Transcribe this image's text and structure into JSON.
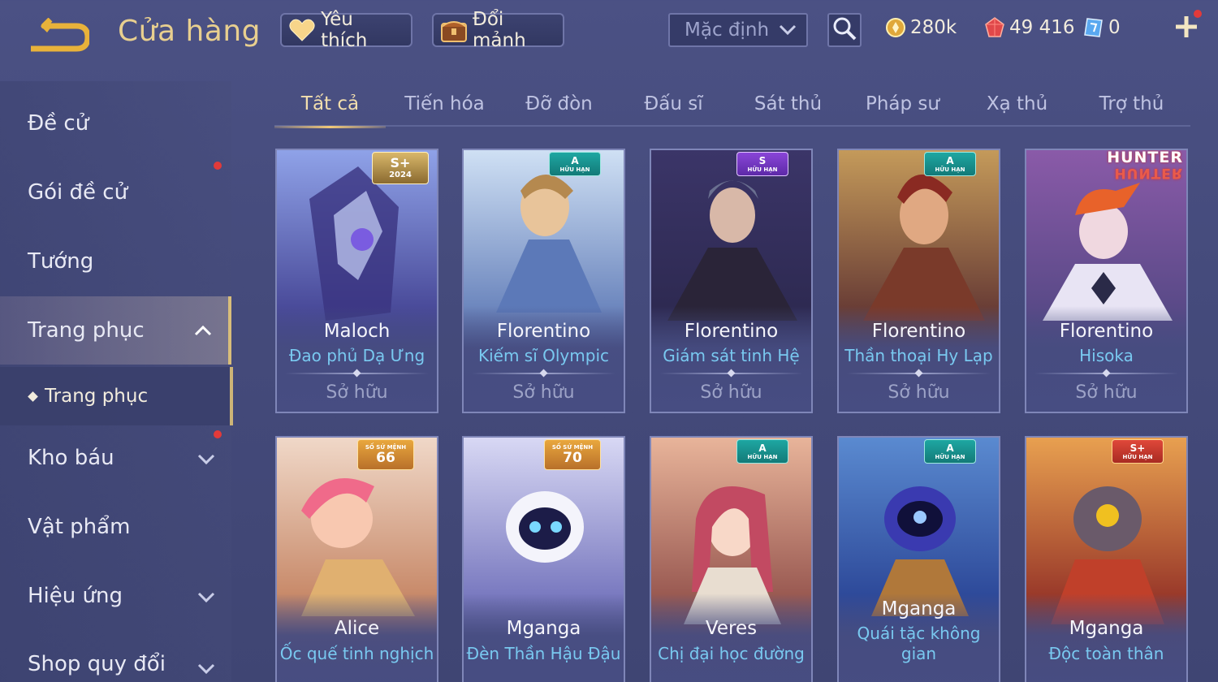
{
  "header": {
    "title": "Cửa hàng",
    "favorites_label": "Yêu thích",
    "exchange_label": "Đổi mảnh",
    "sort_value": "Mặc định",
    "gold": "280k",
    "gems": "49 416",
    "vouchers": "0"
  },
  "sidebar": {
    "items": [
      {
        "label": "Đề cử"
      },
      {
        "label": "Gói đề cử"
      },
      {
        "label": "Tướng"
      },
      {
        "label": "Trang phục"
      },
      {
        "label": "Kho báu"
      },
      {
        "label": "Vật phẩm"
      },
      {
        "label": "Hiệu ứng"
      },
      {
        "label": "Shop quy đổi"
      }
    ],
    "sub_item": "Trang phục"
  },
  "tabs": [
    "Tất cả",
    "Tiến hóa",
    "Đỡ đòn",
    "Đấu sĩ",
    "Sát thủ",
    "Pháp sư",
    "Xạ thủ",
    "Trợ thủ"
  ],
  "cards": [
    {
      "hero": "Maloch",
      "skin": "Đao phủ Dạ Ưng",
      "status": "Sở hữu",
      "badge": "S+",
      "badge_sub": "2024",
      "color": "#5b5fb0"
    },
    {
      "hero": "Florentino",
      "skin": "Kiếm sĩ Olympic",
      "status": "Sở hữu",
      "badge": "A",
      "badge_sub": "HỮU HẠN",
      "color": "#6e8ac2"
    },
    {
      "hero": "Florentino",
      "skin": "Giám sát tinh Hệ",
      "status": "Sở hữu",
      "badge": "S",
      "badge_sub": "HỮU HẠN",
      "color": "#3a3260"
    },
    {
      "hero": "Florentino",
      "skin": "Thần thoại Hy Lạp",
      "status": "Sở hữu",
      "badge": "A",
      "badge_sub": "HỮU HẠN",
      "color": "#8a5a3c"
    },
    {
      "hero": "Florentino",
      "skin": "Hisoka",
      "status": "Sở hữu",
      "logo": "HUNTER",
      "color": "#6a4a8c"
    },
    {
      "hero": "Alice",
      "skin": "Ốc quế tinh nghịch",
      "badge": "SỐ SỨ MỆNH",
      "badge_sub": "66",
      "color": "#d88a6a"
    },
    {
      "hero": "Mganga",
      "skin": "Đèn Thần Hậu Đậu",
      "badge": "SỐ SỨ MỆNH",
      "badge_sub": "70",
      "color": "#8a8ad0"
    },
    {
      "hero": "Veres",
      "skin": "Chị đại học đường",
      "badge": "A",
      "badge_sub": "HỮU HẠN",
      "color": "#b46a5a"
    },
    {
      "hero": "Mganga",
      "skin": "Quái tặc không gian",
      "badge": "A",
      "badge_sub": "HỮU HẠN",
      "color": "#3a5ab0"
    },
    {
      "hero": "Mganga",
      "skin": "Độc toàn thân",
      "badge": "S+",
      "badge_sub": "HỮU HẠN",
      "color": "#b0502a"
    }
  ],
  "colors": {
    "accent_gold": "#e8cf8f",
    "skin_name_blue": "#79c9f0",
    "badge_red_dot": "#e23a3a"
  }
}
